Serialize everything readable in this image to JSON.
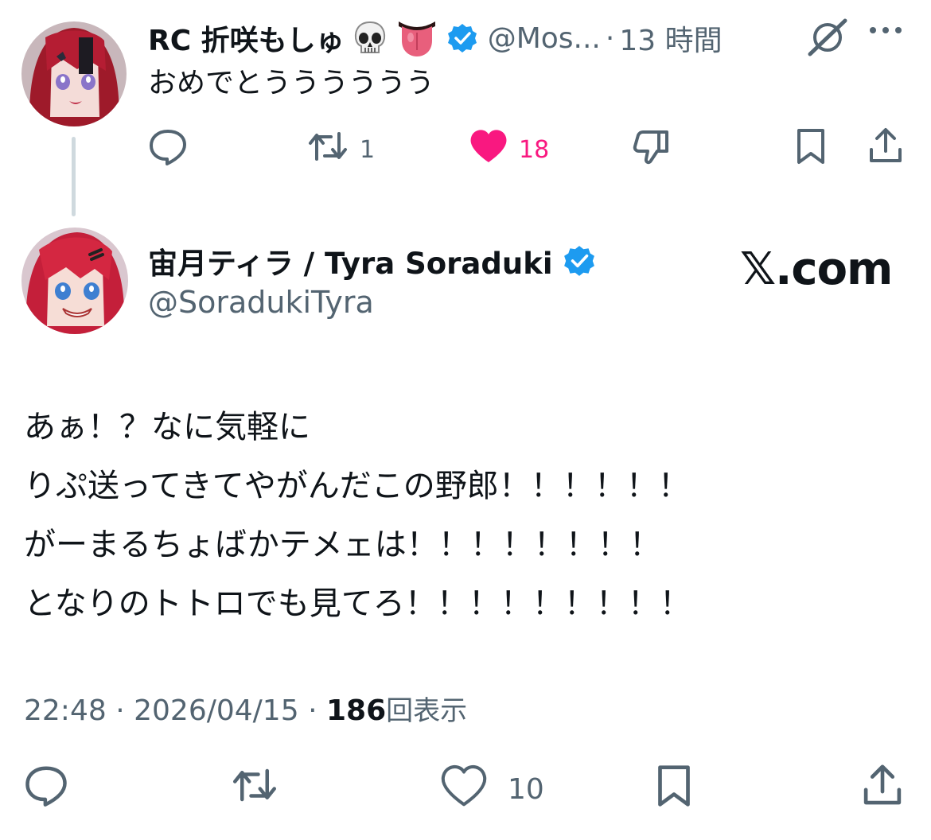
{
  "reply": {
    "display_name": "RC 折咲もしゅ",
    "emojis": [
      "skull",
      "tongue"
    ],
    "verified": true,
    "handle": "@Mos...",
    "separator": "·",
    "time": "13 時間",
    "text": "おめでとうううううう",
    "actions": {
      "reply_icon": "comment-icon",
      "retweet_count": "1",
      "like_count": "18",
      "liked": true,
      "dislike_icon": "thumbs-down-icon",
      "bookmark_icon": "bookmark-icon",
      "share_icon": "share-icon"
    }
  },
  "main": {
    "display_name": "宙月ティラ / Tyra Soraduki",
    "verified": true,
    "handle": "@SoradukiTyra",
    "watermark": "𝕏.com",
    "lines": [
      "あぁ！？なに気軽に",
      "りぷ送ってきてやがんだこの野郎！！！！！！",
      "がーまるちょばかテメェは！！！！！！！！",
      "となりのトトロでも見てろ！！！！！！！！！"
    ],
    "meta": {
      "time": "22:48",
      "sep1": "·",
      "date": "2026/04/15",
      "sep2": "·",
      "views": "186",
      "views_label": "回表示"
    },
    "actions": {
      "like_count": "10"
    }
  },
  "colors": {
    "text": "#0f1419",
    "secondary": "#536471",
    "like_pink": "#f91880",
    "verified_blue": "#1d9bf0",
    "thread_line": "#cfd9de"
  }
}
